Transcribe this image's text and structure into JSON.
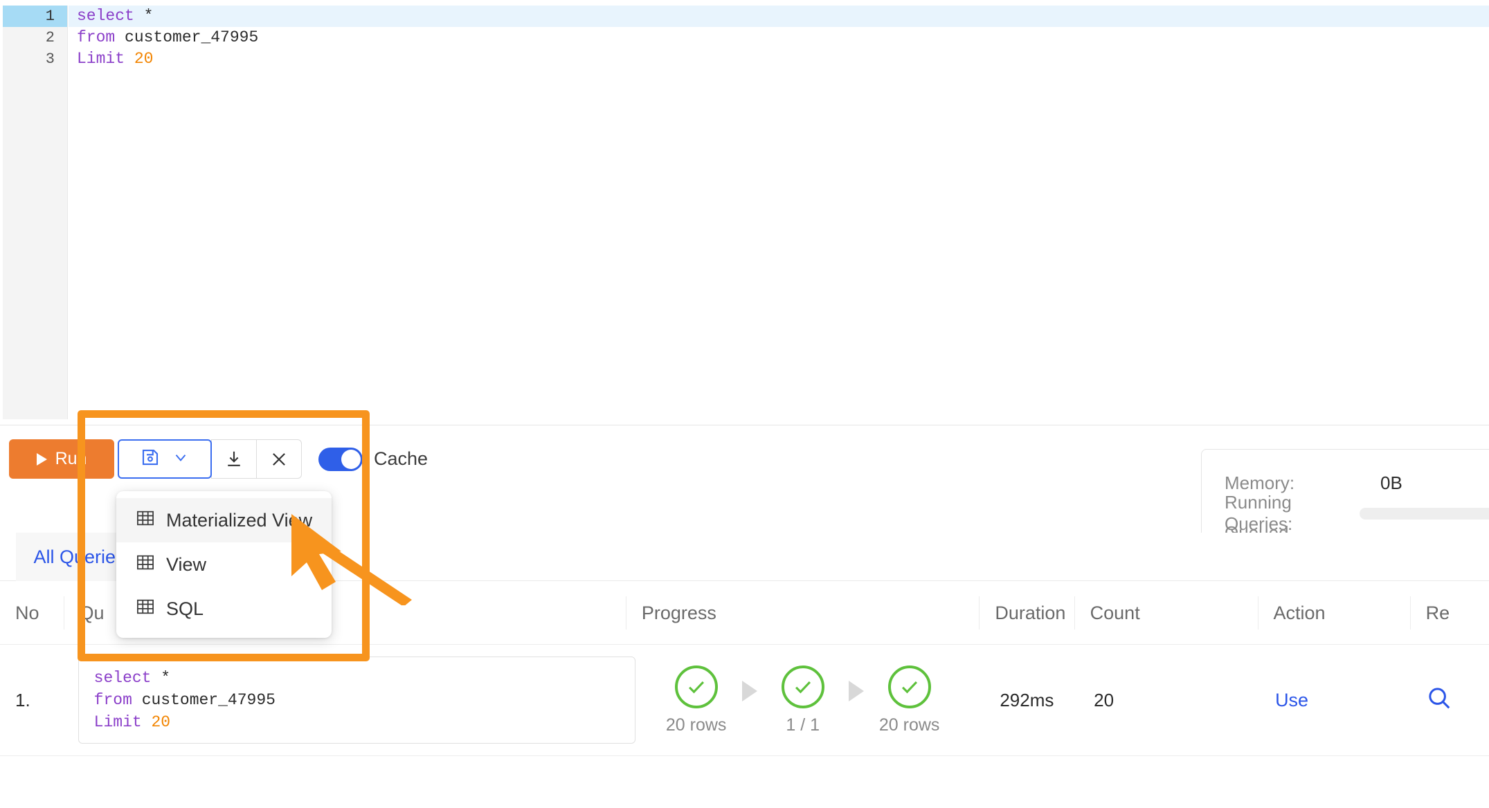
{
  "editor": {
    "lines": [
      {
        "no": "1",
        "active": true,
        "tokens": [
          {
            "t": "select",
            "c": "kw"
          },
          {
            "t": " *",
            "c": "id"
          }
        ]
      },
      {
        "no": "2",
        "active": false,
        "tokens": [
          {
            "t": "from",
            "c": "kw"
          },
          {
            "t": " customer_47995",
            "c": "id"
          }
        ]
      },
      {
        "no": "3",
        "active": false,
        "tokens": [
          {
            "t": "Limit",
            "c": "kw"
          },
          {
            "t": " ",
            "c": "id"
          },
          {
            "t": "20",
            "c": "num"
          }
        ]
      }
    ],
    "plain_sql": "select *\nfrom customer_47995\nLimit 20"
  },
  "toolbar": {
    "run_label": "Run",
    "save_icon": "floppy-disk-icon",
    "dropdown_icon": "chevron-down-icon",
    "download_icon": "download-icon",
    "close_icon": "close-x-icon",
    "cache_label": "Cache",
    "cache_enabled": true
  },
  "dropdown": {
    "items": [
      {
        "label": "Materialized View",
        "icon": "table-grid-icon",
        "hovered": true
      },
      {
        "label": "View",
        "icon": "table-grid-icon",
        "hovered": false
      },
      {
        "label": "SQL",
        "icon": "table-grid-icon",
        "hovered": false
      }
    ]
  },
  "stats": {
    "rows": [
      {
        "label": "Memory:",
        "value": "0B",
        "skeleton": false
      },
      {
        "label": "Running Queries:",
        "value": "",
        "skeleton": true
      },
      {
        "label": "Queued Queries:",
        "value": "",
        "skeleton": true
      }
    ]
  },
  "tabs": [
    {
      "label": "All Queries",
      "active": true
    }
  ],
  "table": {
    "headers": [
      "No",
      "Qu",
      "Progress",
      "Duration",
      "Count",
      "Action",
      "Re"
    ],
    "rows": [
      {
        "no": "1.",
        "query_tokens": [
          {
            "t": "select",
            "c": "kw"
          },
          {
            "t": " *\n",
            "c": "id"
          },
          {
            "t": "from",
            "c": "kw"
          },
          {
            "t": " customer_47995\n",
            "c": "id"
          },
          {
            "t": "Limit",
            "c": "kw"
          },
          {
            "t": " ",
            "c": "id"
          },
          {
            "t": "20",
            "c": "num"
          }
        ],
        "stages": [
          {
            "status": "success",
            "label": "20 rows"
          },
          {
            "status": "success",
            "label": "1 / 1"
          },
          {
            "status": "success",
            "label": "20 rows"
          }
        ],
        "duration": "292ms",
        "count": "20",
        "action": "Use",
        "result_icon": "search-magnifier-icon"
      }
    ]
  },
  "annotation": {
    "box_color": "#f7941e",
    "arrow_color": "#f7941e",
    "target": "Materialized View"
  },
  "colors": {
    "accent_orange": "#ed7c2f",
    "annotation_orange": "#f7941e",
    "link_blue": "#2b55e8",
    "toggle_blue": "#2f5fe8",
    "success_green": "#5ec13c",
    "keyword_purple": "#8b3fc9",
    "number_orange": "#f28400"
  }
}
